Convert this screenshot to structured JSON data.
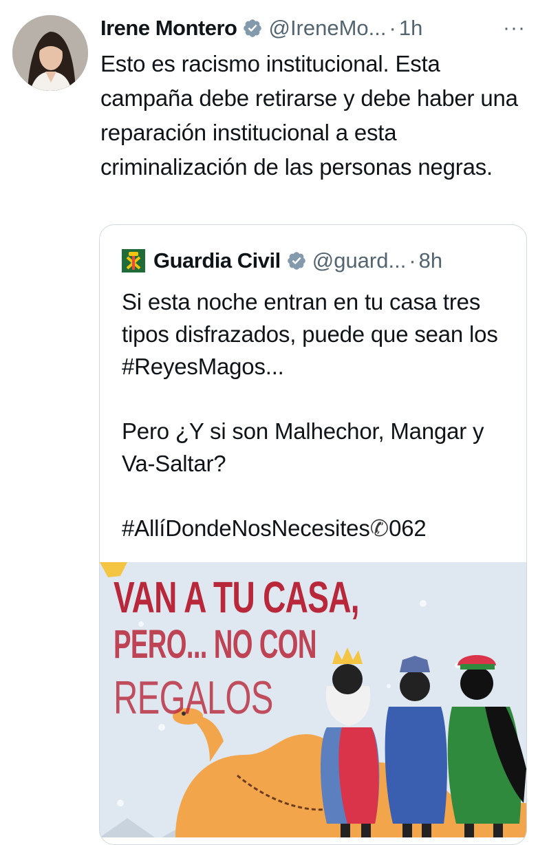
{
  "tweet": {
    "author_name": "Irene Montero",
    "handle": "@IreneMo...",
    "separator": "·",
    "time": "1h",
    "more_label": "···",
    "text": "Esto es racismo institucional. Esta campaña debe retirarse y debe haber una reparación institucional a esta criminalización de las personas negras."
  },
  "quoted": {
    "author_name": "Guardia Civil",
    "handle": "@guard...",
    "separator": "·",
    "time": "8h",
    "paragraph_1": "Si esta noche entran en tu casa tres tipos disfrazados, puede que sean los #ReyesMagos...",
    "paragraph_2": "Pero ¿Y si son Malhechor, Mangar y Va-Saltar?",
    "hashtag": "#AllíDondeNosNecesites",
    "phone_icon": "phone-icon",
    "phone_number": "062",
    "image": {
      "line_1": "VAN A TU CASA,",
      "line_2": "PERO... NO CON",
      "line_3": "REGALOS"
    }
  },
  "colors": {
    "text": "#0f1419",
    "secondary": "#536471",
    "border": "#cfd9de",
    "verified": "#829aab",
    "poster_red": "#b8273a",
    "camel": "#f2a54a"
  }
}
